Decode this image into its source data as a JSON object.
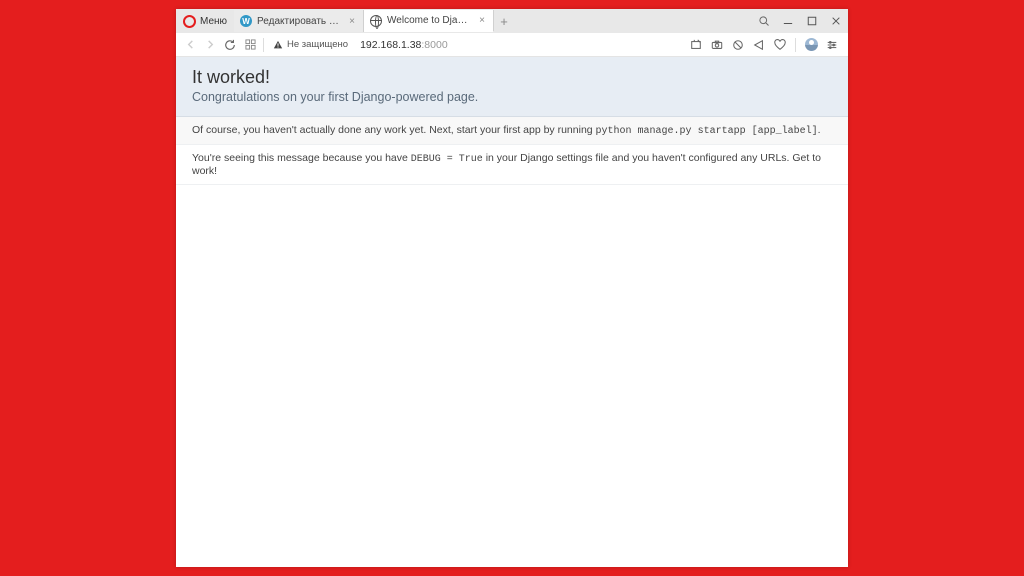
{
  "menu_label": "Меню",
  "tabs": [
    {
      "title": "Редактировать запись ‹ П..."
    },
    {
      "title": "Welcome to Django"
    }
  ],
  "security_label": "Не защищено",
  "url_host": "192.168.1.38",
  "url_port": ":8000",
  "page": {
    "h1": "It worked!",
    "subtitle": "Congratulations on your first Django-powered page.",
    "msg1_pre": "Of course, you haven't actually done any work yet. Next, start your first app by running ",
    "msg1_code": "python manage.py startapp [app_label]",
    "msg1_post": ".",
    "msg2_pre": "You're seeing this message because you have ",
    "msg2_code": "DEBUG = True",
    "msg2_post": " in your Django settings file and you haven't configured any URLs. Get to work!"
  }
}
